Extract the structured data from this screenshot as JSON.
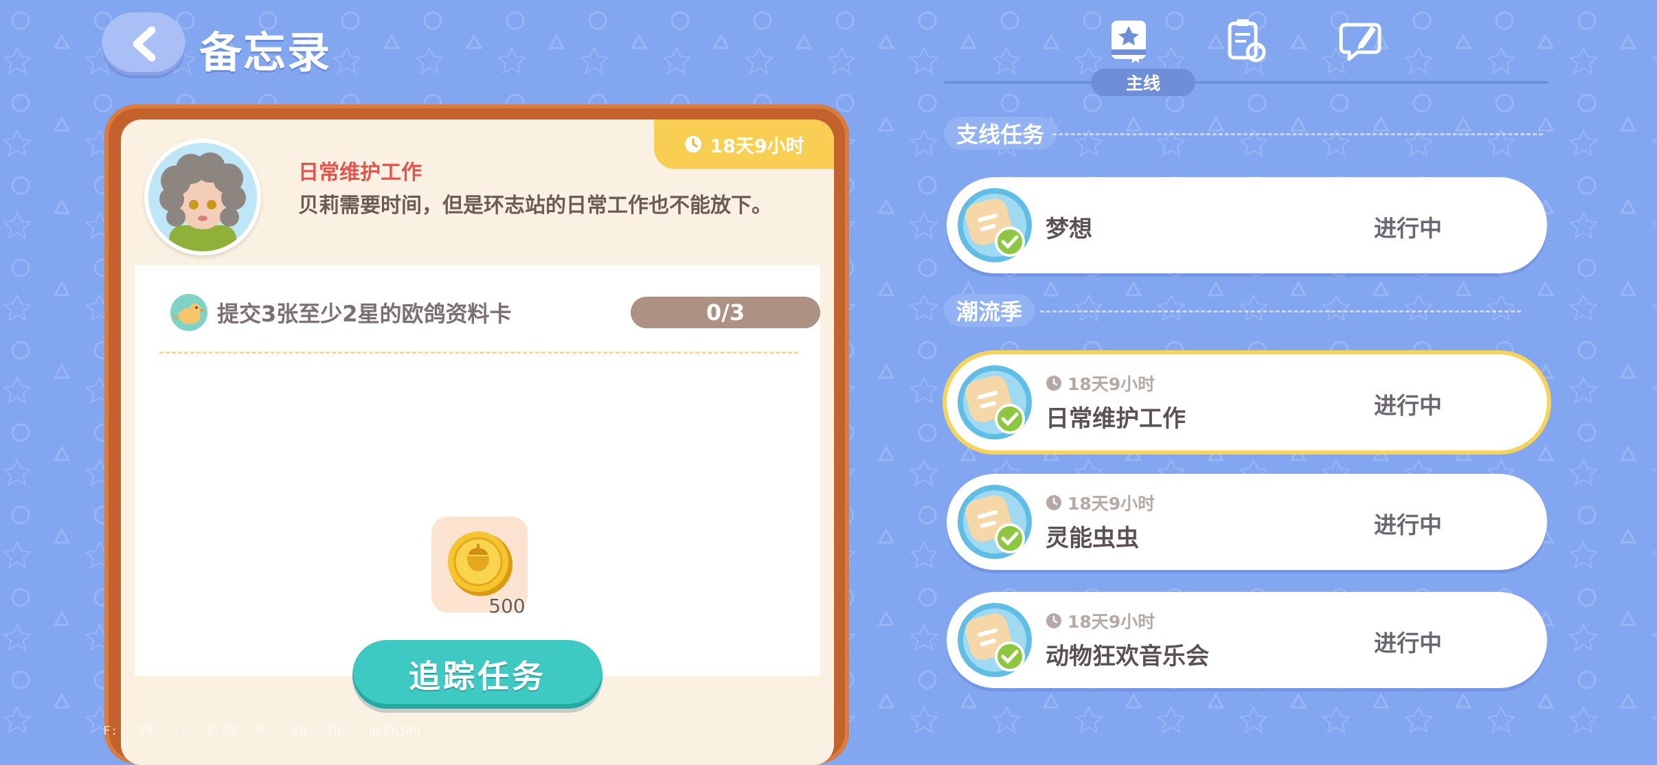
{
  "header": {
    "title": "备忘录",
    "back_icon": "back-arrow-icon"
  },
  "detail": {
    "timer": "18天9小时",
    "quest_name": "日常维护工作",
    "quest_description": "贝莉需要时间，但是环志站的日常工作也不能放下。",
    "task": {
      "text": "提交3张至少2星的欧鸽资料卡",
      "progress": "0/3",
      "progress_fraction": 0
    },
    "reward": {
      "icon": "acorn-coin-icon",
      "amount": "500"
    },
    "track_button": "追踪任务"
  },
  "debug_text": "F: 29   T: 0.00   P: 50   ID: qp0h34n",
  "tabs": [
    {
      "icon": "main-quest-book-icon",
      "label": "主线",
      "active": true
    },
    {
      "icon": "clipboard-refresh-icon",
      "active": false
    },
    {
      "icon": "chat-pencil-icon",
      "active": false
    }
  ],
  "sections": [
    {
      "title": "支线任务",
      "items": [
        {
          "name": "梦想",
          "status": "进行中",
          "timer": null
        }
      ]
    },
    {
      "title": "潮流季",
      "items": [
        {
          "name": "日常维护工作",
          "status": "进行中",
          "timer": "18天9小时",
          "selected": true
        },
        {
          "name": "灵能虫虫",
          "status": "进行中",
          "timer": "18天9小时"
        },
        {
          "name": "动物狂欢音乐会",
          "status": "进行中",
          "timer": "18天9小时"
        }
      ]
    }
  ],
  "colors": {
    "background": "#83a6f0",
    "card_border": "#c4622d",
    "accent_teal": "#3ecac3",
    "timer_yellow": "#f8cf52"
  }
}
